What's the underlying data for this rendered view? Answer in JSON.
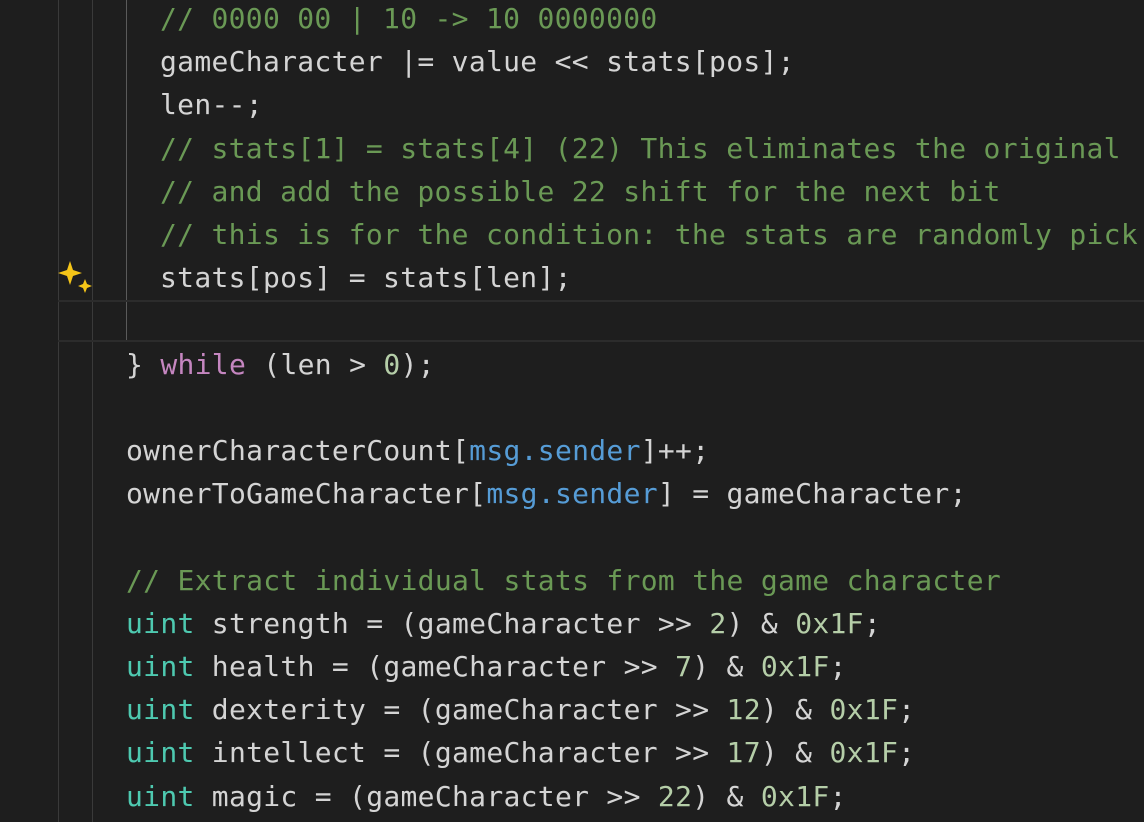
{
  "editor": {
    "lines": [
      {
        "indent": 2,
        "tokens": [
          {
            "t": "// 0000 00 | 10 -> 10 0000000",
            "k": "comment"
          }
        ]
      },
      {
        "indent": 2,
        "tokens": [
          {
            "t": "gameCharacter |= value << stats[pos];",
            "k": "plain"
          }
        ]
      },
      {
        "indent": 2,
        "tokens": [
          {
            "t": "len--;",
            "k": "plain"
          }
        ]
      },
      {
        "indent": 2,
        "tokens": [
          {
            "t": "// stats[1] = stats[4] (22) This eliminates the original",
            "k": "comment"
          }
        ]
      },
      {
        "indent": 2,
        "tokens": [
          {
            "t": "// and add the possible 22 shift for the next bit",
            "k": "comment"
          }
        ]
      },
      {
        "indent": 2,
        "tokens": [
          {
            "t": "// this is for the condition: the stats are randomly pick",
            "k": "comment"
          }
        ]
      },
      {
        "indent": 2,
        "tokens": [
          {
            "t": "stats[pos] = stats[len];",
            "k": "plain"
          }
        ]
      },
      {
        "indent": 2,
        "tokens": []
      },
      {
        "indent": 1,
        "tokens": [
          {
            "t": "} ",
            "k": "plain"
          },
          {
            "t": "while",
            "k": "keyword"
          },
          {
            "t": " (len > ",
            "k": "plain"
          },
          {
            "t": "0",
            "k": "number"
          },
          {
            "t": ");",
            "k": "plain"
          }
        ]
      },
      {
        "indent": 1,
        "tokens": []
      },
      {
        "indent": 1,
        "tokens": [
          {
            "t": "ownerCharacterCount[",
            "k": "plain"
          },
          {
            "t": "msg.sender",
            "k": "builtin"
          },
          {
            "t": "]++;",
            "k": "plain"
          }
        ]
      },
      {
        "indent": 1,
        "tokens": [
          {
            "t": "ownerToGameCharacter[",
            "k": "plain"
          },
          {
            "t": "msg.sender",
            "k": "builtin"
          },
          {
            "t": "] = gameCharacter;",
            "k": "plain"
          }
        ]
      },
      {
        "indent": 1,
        "tokens": []
      },
      {
        "indent": 1,
        "tokens": [
          {
            "t": "// Extract individual stats from the game character",
            "k": "comment"
          }
        ]
      },
      {
        "indent": 1,
        "tokens": [
          {
            "t": "uint",
            "k": "type"
          },
          {
            "t": " strength = (gameCharacter >> ",
            "k": "plain"
          },
          {
            "t": "2",
            "k": "number"
          },
          {
            "t": ") & ",
            "k": "plain"
          },
          {
            "t": "0x1F",
            "k": "number"
          },
          {
            "t": ";",
            "k": "plain"
          }
        ]
      },
      {
        "indent": 1,
        "tokens": [
          {
            "t": "uint",
            "k": "type"
          },
          {
            "t": " health = (gameCharacter >> ",
            "k": "plain"
          },
          {
            "t": "7",
            "k": "number"
          },
          {
            "t": ") & ",
            "k": "plain"
          },
          {
            "t": "0x1F",
            "k": "number"
          },
          {
            "t": ";",
            "k": "plain"
          }
        ]
      },
      {
        "indent": 1,
        "tokens": [
          {
            "t": "uint",
            "k": "type"
          },
          {
            "t": " dexterity = (gameCharacter >> ",
            "k": "plain"
          },
          {
            "t": "12",
            "k": "number"
          },
          {
            "t": ") & ",
            "k": "plain"
          },
          {
            "t": "0x1F",
            "k": "number"
          },
          {
            "t": ";",
            "k": "plain"
          }
        ]
      },
      {
        "indent": 1,
        "tokens": [
          {
            "t": "uint",
            "k": "type"
          },
          {
            "t": " intellect = (gameCharacter >> ",
            "k": "plain"
          },
          {
            "t": "17",
            "k": "number"
          },
          {
            "t": ") & ",
            "k": "plain"
          },
          {
            "t": "0x1F",
            "k": "number"
          },
          {
            "t": ";",
            "k": "plain"
          }
        ]
      },
      {
        "indent": 1,
        "tokens": [
          {
            "t": "uint",
            "k": "type"
          },
          {
            "t": " magic = (gameCharacter >> ",
            "k": "plain"
          },
          {
            "t": "22",
            "k": "number"
          },
          {
            "t": ") & ",
            "k": "plain"
          },
          {
            "t": "0x1F",
            "k": "number"
          },
          {
            "t": ";",
            "k": "plain"
          }
        ]
      }
    ],
    "gutter_icon": "copilot-sparkle-icon",
    "colors": {
      "background": "#1e1e1e",
      "comment": "#6a9955",
      "keyword": "#c586c0",
      "type": "#4ec9b0",
      "number": "#b5cea8",
      "builtin": "#569cd6",
      "plain": "#d4d4d4",
      "sparkle": "#f5c518"
    }
  }
}
